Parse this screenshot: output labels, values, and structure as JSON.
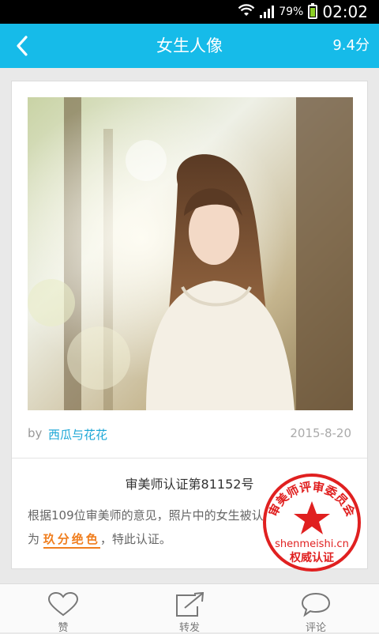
{
  "status_bar": {
    "battery_percent": "79%",
    "time": "02:02",
    "icons": [
      "wifi-icon",
      "signal-icon",
      "battery-icon"
    ]
  },
  "header": {
    "back_icon": "chevron-left-icon",
    "title": "女生人像",
    "score": "9.4分",
    "color": "#16bbe9"
  },
  "post": {
    "by_label": "by",
    "author": "西瓜与花花",
    "date": "2015-8-20",
    "certificate": {
      "title": "审美师认证第81152号",
      "body_prefix": "根据109位审美师的意见，照片中的女生被认",
      "body_line2_prefix": "为",
      "rating": "玖分绝色",
      "body_suffix": "，特此认证。"
    },
    "stamp": {
      "top_text": "审美师评审委员会",
      "domain": "shenmeishi.cn",
      "bottom_text": "权威认证",
      "color": "#e02020"
    }
  },
  "bottom_bar": {
    "like_label": "赞",
    "share_label": "转发",
    "comment_label": "评论"
  }
}
